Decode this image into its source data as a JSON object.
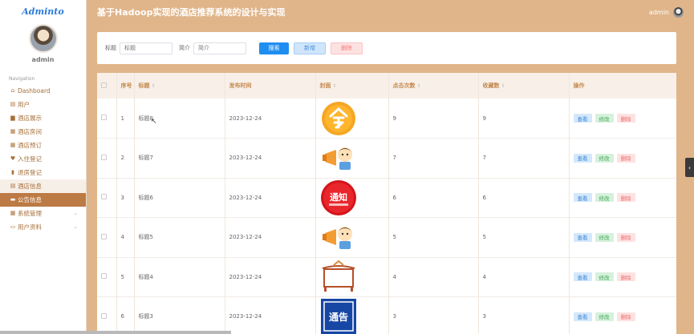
{
  "app": {
    "logo": "Adminto",
    "user_name": "admin",
    "nav_title": "Navigation",
    "header_title": "基于Hadoop实现的酒店推荐系统的设计与实现",
    "header_user": "admin"
  },
  "sidebar": {
    "items": [
      {
        "label": "Dashboard",
        "icon": "home-icon"
      },
      {
        "label": "用户",
        "icon": "table-icon"
      },
      {
        "label": "酒店展示",
        "icon": "briefcase-icon"
      },
      {
        "label": "酒店房间",
        "icon": "grid-icon"
      },
      {
        "label": "酒店预订",
        "icon": "grid-icon"
      },
      {
        "label": "入住登记",
        "icon": "location-icon"
      },
      {
        "label": "退房登记",
        "icon": "bar-chart-icon"
      },
      {
        "label": "酒店信息",
        "icon": "table-icon"
      },
      {
        "label": "公告信息",
        "icon": "message-icon"
      },
      {
        "label": "系统管理",
        "icon": "grid-icon"
      },
      {
        "label": "用户资料",
        "icon": "profile-icon"
      }
    ]
  },
  "search": {
    "title_label": "标题",
    "title_placeholder": "标题",
    "brief_label": "简介",
    "brief_placeholder": "简介",
    "search_btn": "搜索",
    "add_btn": "新增",
    "delete_btn": "删除"
  },
  "table": {
    "headers": [
      "序号",
      "标题",
      "发布时间",
      "封面",
      "点击次数",
      "收藏数",
      "操作"
    ],
    "rows": [
      {
        "index": "1",
        "title": "标题8",
        "date": "2023-12-24",
        "clicks": "9",
        "favs": "9",
        "cover": "ling-icon"
      },
      {
        "index": "2",
        "title": "标题7",
        "date": "2023-12-24",
        "clicks": "7",
        "favs": "7",
        "cover": "megaphone-kid-icon"
      },
      {
        "index": "3",
        "title": "标题6",
        "date": "2023-12-24",
        "clicks": "6",
        "favs": "6",
        "cover": "notice-badge-icon"
      },
      {
        "index": "4",
        "title": "标题5",
        "date": "2023-12-24",
        "clicks": "5",
        "favs": "5",
        "cover": "megaphone-kid-icon"
      },
      {
        "index": "5",
        "title": "标题4",
        "date": "2023-12-24",
        "clicks": "4",
        "favs": "4",
        "cover": "notice-board-icon"
      },
      {
        "index": "6",
        "title": "标题3",
        "date": "2023-12-24",
        "clicks": "3",
        "favs": "3",
        "cover": "announcement-icon"
      }
    ],
    "op_view": "查看",
    "op_edit": "修改",
    "op_delete": "删除"
  }
}
